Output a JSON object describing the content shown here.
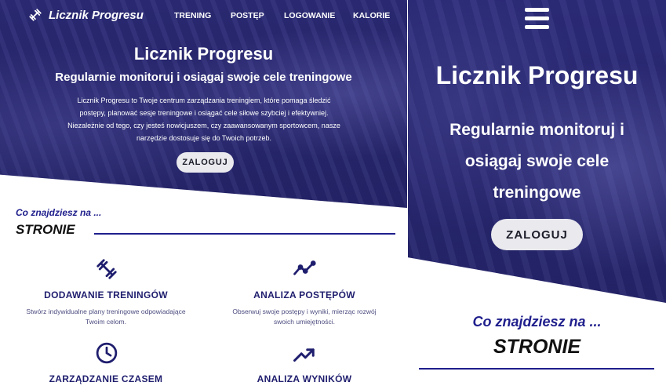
{
  "brand": {
    "name": "Licznik Progresu",
    "icon": "dumbbell-icon"
  },
  "nav": [
    {
      "label": "TRENING"
    },
    {
      "label": "POSTĘP"
    },
    {
      "label": "LOGOWANIE"
    },
    {
      "label": "KALORIE"
    }
  ],
  "hero": {
    "title": "Licznik Progresu",
    "subtitle": "Regularnie monitoruj i osiągaj swoje cele treningowe",
    "description_lines": [
      "Licznik Progresu to Twoje centrum zarządzania treningiem, które pomaga śledzić",
      "postępy, planować sesje treningowe i osiągać cele siłowe szybciej i efektywniej.",
      "Niezależnie od tego, czy jesteś nowicjuszem, czy zaawansowanym sportowcem, nasze",
      "narzędzie dostosuje się do Twoich potrzeb."
    ],
    "button": "ZALOGUJ"
  },
  "section": {
    "intro": "Co znajdziesz na ...",
    "heading": "STRONIE"
  },
  "features": [
    {
      "title": "DODAWANIE TRENINGÓW",
      "desc_lines": [
        "Stwórz indywidualne plany treningowe odpowiadające",
        "Twoim celom."
      ],
      "icon": "dumbbell-icon"
    },
    {
      "title": "ANALIZA POSTĘPÓW",
      "desc_lines": [
        "Obserwuj swoje postępy i wyniki, mierząc rozwój",
        "swoich umiejętności."
      ],
      "icon": "line-chart-icon"
    },
    {
      "title": "ZARZĄDZANIE CZASEM",
      "desc_lines": [],
      "icon": "clock-icon"
    },
    {
      "title": "ANALIZA WYNIKÓW",
      "desc_lines": [],
      "icon": "trending-up-icon"
    }
  ],
  "mobile": {
    "menu_icon": "hamburger-menu-icon",
    "subtitle_lines": [
      "Regularnie monitoruj i",
      "osiągaj swoje cele",
      "treningowe"
    ]
  },
  "colors": {
    "hero": "#27266e",
    "accent": "#1f1e8c",
    "button": "#e9e9ee"
  }
}
